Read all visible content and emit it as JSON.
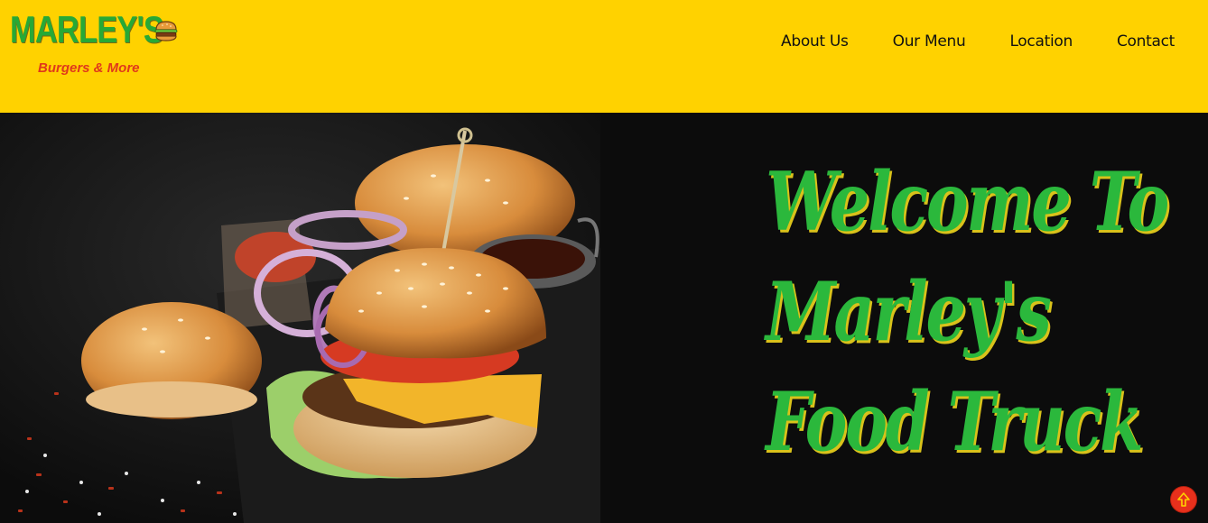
{
  "brand": {
    "name": "MARLEY'S",
    "tagline": "Burgers & More",
    "logo_icon": "burger-icon"
  },
  "nav": {
    "items": [
      {
        "label": "About Us"
      },
      {
        "label": "Our Menu"
      },
      {
        "label": "Location"
      },
      {
        "label": "Contact"
      }
    ]
  },
  "hero": {
    "title_lines": [
      "Welcome To",
      "Marley's",
      "Food Truck"
    ],
    "image": "burger-photo"
  },
  "scroll_top": {
    "icon": "arrow-up-icon"
  },
  "colors": {
    "header_bg": "#ffd200",
    "brand_green": "#2bb83c",
    "tagline_red": "#e0391b",
    "hero_bg": "#0c0c0c",
    "button_red": "#e8301c"
  }
}
